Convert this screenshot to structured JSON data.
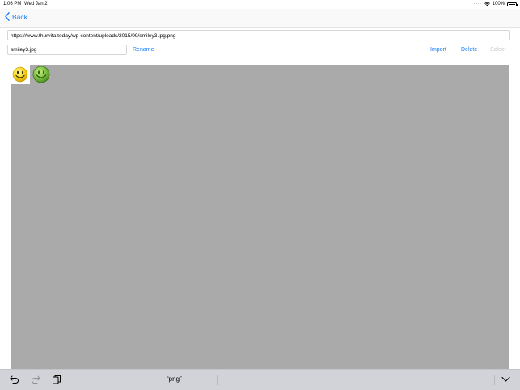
{
  "status": {
    "time": "1:06 PM",
    "date": "Wed Jan 2",
    "battery": "100%"
  },
  "nav": {
    "back_label": "Back"
  },
  "url_field": {
    "value": "https://www.thurvita.today/wp-content/uploads/2015/09/smiley3.jpg.png"
  },
  "filename_field": {
    "value": "smiley3.jpg"
  },
  "actions": {
    "rename": "Rename",
    "import": "Import",
    "delete": "Delete",
    "select": "Select"
  },
  "images": [
    {
      "icon": "yellow-smiley",
      "selected": true
    },
    {
      "icon": "green-smiley",
      "selected": false
    }
  ],
  "keyboard_bar": {
    "suggestion": "“png”"
  },
  "colors": {
    "accent": "#157efb",
    "canvas": "#aaaaaa",
    "toolbar": "#d1d3d9"
  }
}
